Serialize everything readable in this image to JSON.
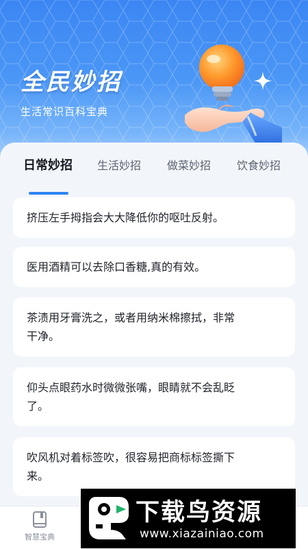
{
  "header": {
    "title": "全民妙招",
    "subtitle": "生活常识百科宝典",
    "illustration_icon": "hand-holding-lightbulb-icon",
    "sparkle_icon": "sparkle-icon"
  },
  "tabs": [
    {
      "label": "日常妙招",
      "active": true
    },
    {
      "label": "生活妙招",
      "active": false
    },
    {
      "label": "做菜妙招",
      "active": false
    },
    {
      "label": "饮食妙招",
      "active": false
    }
  ],
  "tips": [
    {
      "lines": [
        "挤压左手拇指会大大降低你的呕吐反射。"
      ]
    },
    {
      "lines": [
        "医用酒精可以去除口香糖,真的有效。"
      ]
    },
    {
      "lines": [
        "茶渍用牙膏洗之，或者用纳米棉擦拭，非常",
        "干净。"
      ]
    },
    {
      "lines": [
        "仰头点眼药水时微微张嘴，眼睛就不会乱眨",
        "了。"
      ]
    },
    {
      "lines": [
        "吹风机对着标签吹，很容易把商标标签撕下",
        "来。"
      ]
    }
  ],
  "bottom_nav": {
    "items": [
      {
        "label": "智慧宝典",
        "icon": "book-icon"
      }
    ]
  },
  "watermark": {
    "title": "下载鸟资源",
    "url": "www.xiazainiao.com",
    "logo_icon": "bird-logo-icon"
  },
  "colors": {
    "accent": "#2d83f1",
    "hero_top": "#3b86f3",
    "card_bg": "#ffffff",
    "page_bg": "#f2f6fb"
  }
}
